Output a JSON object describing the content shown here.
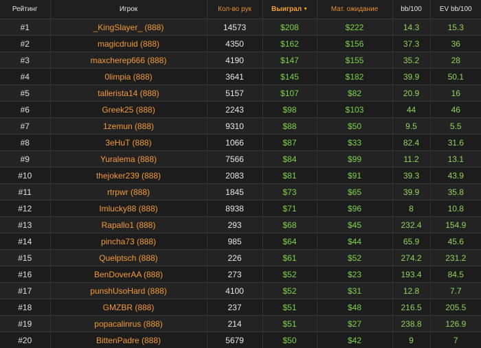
{
  "table": {
    "headers": {
      "rank": "Рейтинг",
      "player": "Игрок",
      "hands": "Кол-во рук",
      "won": "Выиграл",
      "ev": "Мат. ожидание",
      "bb100": "bb/100",
      "ev_bb100": "EV bb/100"
    },
    "sort": {
      "column": "won",
      "direction": "descending",
      "icon": "sort-desc-icon"
    },
    "colors": {
      "player_link": "#f39a36",
      "money": "#7dd34a",
      "header_accent": "#e8902e",
      "background": "#1e1e1e"
    },
    "rows": [
      {
        "rank": "#1",
        "player": "_KingSlayer_ (888)",
        "hands": "14573",
        "won": "$208",
        "ev": "$222",
        "bb100": "14.3",
        "ev_bb100": "15.3"
      },
      {
        "rank": "#2",
        "player": "magicdruid (888)",
        "hands": "4350",
        "won": "$162",
        "ev": "$156",
        "bb100": "37.3",
        "ev_bb100": "36"
      },
      {
        "rank": "#3",
        "player": "maxcherep666 (888)",
        "hands": "4190",
        "won": "$147",
        "ev": "$155",
        "bb100": "35.2",
        "ev_bb100": "28"
      },
      {
        "rank": "#4",
        "player": "0limpia (888)",
        "hands": "3641",
        "won": "$145",
        "ev": "$182",
        "bb100": "39.9",
        "ev_bb100": "50.1"
      },
      {
        "rank": "#5",
        "player": "tallerista14 (888)",
        "hands": "5157",
        "won": "$107",
        "ev": "$82",
        "bb100": "20.9",
        "ev_bb100": "16"
      },
      {
        "rank": "#6",
        "player": "Greek25 (888)",
        "hands": "2243",
        "won": "$98",
        "ev": "$103",
        "bb100": "44",
        "ev_bb100": "46"
      },
      {
        "rank": "#7",
        "player": "1zemun (888)",
        "hands": "9310",
        "won": "$88",
        "ev": "$50",
        "bb100": "9.5",
        "ev_bb100": "5.5"
      },
      {
        "rank": "#8",
        "player": "3eHuT (888)",
        "hands": "1066",
        "won": "$87",
        "ev": "$33",
        "bb100": "82.4",
        "ev_bb100": "31.6"
      },
      {
        "rank": "#9",
        "player": "Yuralema (888)",
        "hands": "7566",
        "won": "$84",
        "ev": "$99",
        "bb100": "11.2",
        "ev_bb100": "13.1"
      },
      {
        "rank": "#10",
        "player": "thejoker239 (888)",
        "hands": "2083",
        "won": "$81",
        "ev": "$91",
        "bb100": "39.3",
        "ev_bb100": "43.9"
      },
      {
        "rank": "#11",
        "player": "rtrpwr (888)",
        "hands": "1845",
        "won": "$73",
        "ev": "$65",
        "bb100": "39.9",
        "ev_bb100": "35.8"
      },
      {
        "rank": "#12",
        "player": "Imlucky88 (888)",
        "hands": "8938",
        "won": "$71",
        "ev": "$96",
        "bb100": "8",
        "ev_bb100": "10.8"
      },
      {
        "rank": "#13",
        "player": "Rapallo1 (888)",
        "hands": "293",
        "won": "$68",
        "ev": "$45",
        "bb100": "232.4",
        "ev_bb100": "154.9"
      },
      {
        "rank": "#14",
        "player": "pincha73 (888)",
        "hands": "985",
        "won": "$64",
        "ev": "$44",
        "bb100": "65.9",
        "ev_bb100": "45.6"
      },
      {
        "rank": "#15",
        "player": "Quelptsch (888)",
        "hands": "226",
        "won": "$61",
        "ev": "$52",
        "bb100": "274.2",
        "ev_bb100": "231.2"
      },
      {
        "rank": "#16",
        "player": "BenDoverAA (888)",
        "hands": "273",
        "won": "$52",
        "ev": "$23",
        "bb100": "193.4",
        "ev_bb100": "84.5"
      },
      {
        "rank": "#17",
        "player": "punshUsoHard (888)",
        "hands": "4100",
        "won": "$52",
        "ev": "$31",
        "bb100": "12.8",
        "ev_bb100": "7.7"
      },
      {
        "rank": "#18",
        "player": "GMZBR (888)",
        "hands": "237",
        "won": "$51",
        "ev": "$48",
        "bb100": "216.5",
        "ev_bb100": "205.5"
      },
      {
        "rank": "#19",
        "player": "popacalinrus (888)",
        "hands": "214",
        "won": "$51",
        "ev": "$27",
        "bb100": "238.8",
        "ev_bb100": "126.9"
      },
      {
        "rank": "#20",
        "player": "BittenPadre (888)",
        "hands": "5679",
        "won": "$50",
        "ev": "$42",
        "bb100": "9",
        "ev_bb100": "7"
      }
    ]
  }
}
